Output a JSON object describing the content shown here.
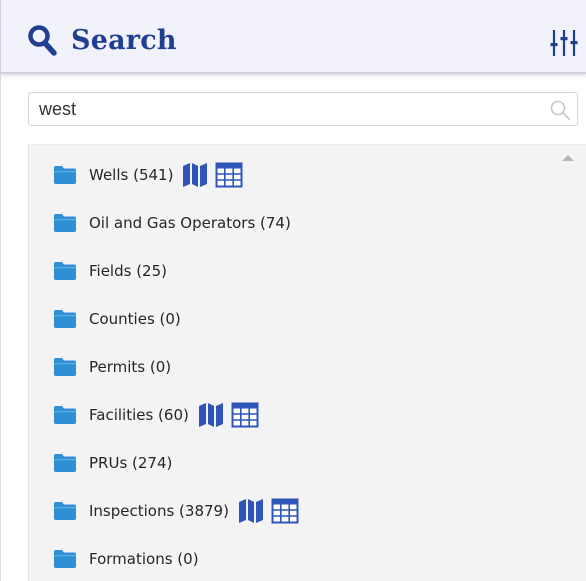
{
  "header": {
    "title": "Search",
    "search_icon": "search-icon",
    "filter_icon": "sliders-icon"
  },
  "search": {
    "value": "west",
    "placeholder": "",
    "icon": "search-icon"
  },
  "colors": {
    "accent": "#203f91",
    "folder": "#2f8fd6",
    "action_icon": "#2f55b8"
  },
  "results": {
    "items": [
      {
        "label": "Wells (541)",
        "has_map": true,
        "has_table": true
      },
      {
        "label": "Oil and Gas Operators (74)",
        "has_map": false,
        "has_table": false
      },
      {
        "label": "Fields (25)",
        "has_map": false,
        "has_table": false
      },
      {
        "label": "Counties (0)",
        "has_map": false,
        "has_table": false
      },
      {
        "label": "Permits (0)",
        "has_map": false,
        "has_table": false
      },
      {
        "label": "Facilities (60)",
        "has_map": true,
        "has_table": true
      },
      {
        "label": "PRUs (274)",
        "has_map": false,
        "has_table": false
      },
      {
        "label": "Inspections (3879)",
        "has_map": true,
        "has_table": true
      },
      {
        "label": "Formations (0)",
        "has_map": false,
        "has_table": false
      }
    ]
  }
}
